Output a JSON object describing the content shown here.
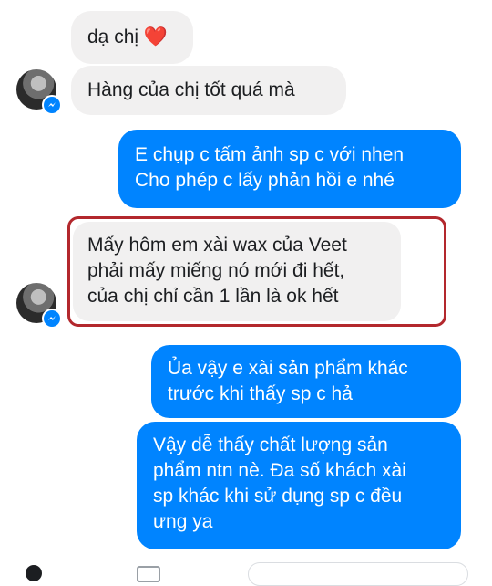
{
  "messages": [
    {
      "side": "in",
      "lines": [
        "dạ chị ❤️"
      ]
    },
    {
      "side": "in",
      "lines": [
        "Hàng của chị tốt quá mà"
      ]
    },
    {
      "side": "out",
      "lines": [
        "E chụp c tấm ảnh sp c với nhen",
        "Cho phép c lấy phản hồi e nhé"
      ]
    },
    {
      "side": "in",
      "lines": [
        "Mấy hôm em xài wax của Veet",
        "phải mấy miếng nó mới đi hết,",
        "của chị chỉ cần 1 lần là ok hết"
      ]
    },
    {
      "side": "out",
      "lines": [
        "Ủa vậy e xài sản phẩm khác",
        "trước khi thấy sp c hả"
      ]
    },
    {
      "side": "out",
      "lines": [
        "Vậy dễ thấy chất lượng sản",
        "phẩm ntn nè. Đa số khách xài",
        "sp khác khi sử dụng sp c đều",
        "ưng ya"
      ]
    }
  ],
  "colors": {
    "incoming_bubble": "#f1f0f0",
    "outgoing_bubble": "#0084ff",
    "highlight_border": "#b3282d"
  },
  "icons": {
    "avatar_badge": "messenger-icon"
  }
}
